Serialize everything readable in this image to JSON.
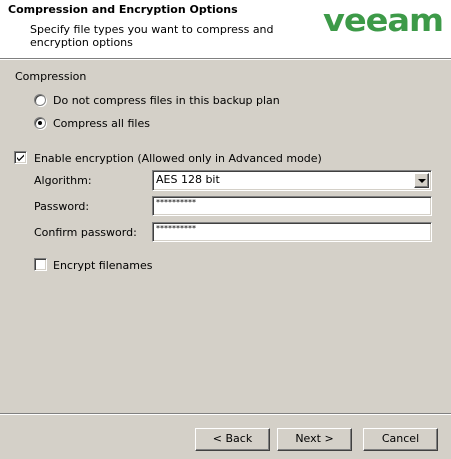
{
  "header": {
    "title": "Compression and Encryption Options",
    "description": "Specify file types you want to compress and encryption options",
    "logo_text": "veeam",
    "logo_color": "#3d9a48"
  },
  "compression": {
    "group_label": "Compression",
    "options": [
      {
        "label": "Do not compress files in this backup plan",
        "selected": false
      },
      {
        "label": "Compress all files",
        "selected": true
      }
    ]
  },
  "encryption": {
    "enable_label": "Enable encryption (Allowed only in Advanced mode)",
    "enabled": true,
    "algorithm_label": "Algorithm:",
    "algorithm_value": "AES 128 bit",
    "password_label": "Password:",
    "password_value": "**********",
    "confirm_label": "Confirm password:",
    "confirm_value": "**********",
    "encrypt_filenames_label": "Encrypt filenames",
    "encrypt_filenames": false
  },
  "buttons": {
    "back": "< Back",
    "next": "Next >",
    "cancel": "Cancel"
  }
}
